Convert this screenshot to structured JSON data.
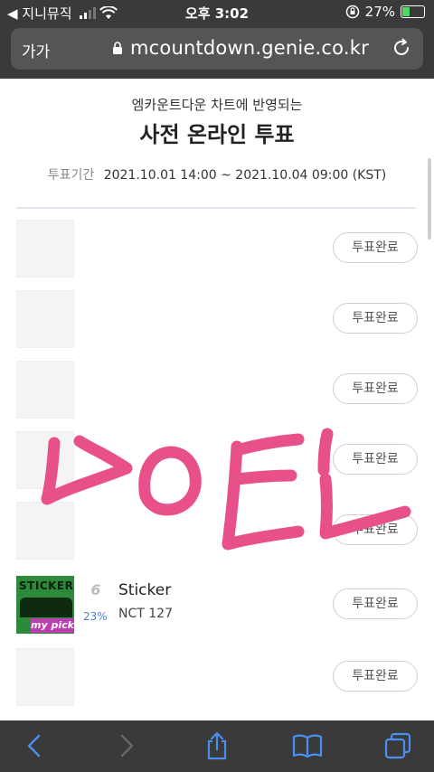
{
  "status": {
    "carrier": "◀ 지니뮤직",
    "time": "오후 3:02",
    "battery": "27%"
  },
  "browser": {
    "text_size": "가가",
    "url": "mcountdown.genie.co.kr"
  },
  "header": {
    "subtitle": "엠카운트다운 차트에 반영되는",
    "title": "사전 온라인 투표",
    "period_label": "투표기간",
    "period_value": "2021.10.01 14:00 ~ 2021.10.04 09:00 (KST)"
  },
  "rows": [
    {
      "rank": "",
      "pct": "",
      "song": "",
      "artist": "",
      "button": "투표완료"
    },
    {
      "rank": "",
      "pct": "",
      "song": "",
      "artist": "",
      "button": "투표완료"
    },
    {
      "rank": "",
      "pct": "",
      "song": "",
      "artist": "",
      "button": "투표완료"
    },
    {
      "rank": "",
      "pct": "",
      "song": "",
      "artist": "",
      "button": "투표완료"
    },
    {
      "rank": "",
      "pct": "",
      "song": "",
      "artist": "",
      "button": "투표완료"
    },
    {
      "rank": "6",
      "pct": "23%",
      "song": "Sticker",
      "artist": "NCT 127",
      "button": "투표완료",
      "album_title": "STICKER",
      "album_badge": "my pick"
    },
    {
      "rank": "",
      "pct": "",
      "song": "",
      "artist": "",
      "button": "투표완료"
    }
  ],
  "colors": {
    "scribble": "#e8508a",
    "accent_pct": "#4a80d8",
    "album_green": "#2c8a3a",
    "badge": "#b93fae"
  }
}
